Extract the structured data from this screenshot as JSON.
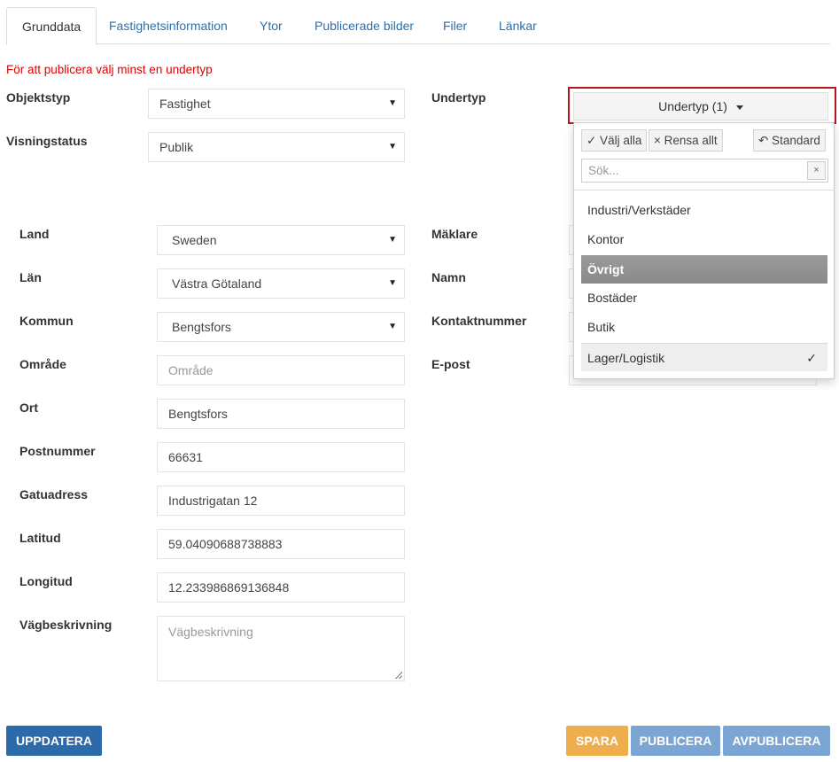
{
  "tabs": [
    {
      "label": "Grunddata",
      "active": true
    },
    {
      "label": "Fastighetsinformation"
    },
    {
      "label": "Ytor"
    },
    {
      "label": "Publicerade bilder"
    },
    {
      "label": "Filer"
    },
    {
      "label": "Länkar"
    }
  ],
  "warning": "För att publicera välj minst en undertyp",
  "form": {
    "objektstyp": {
      "label": "Objektstyp",
      "value": "Fastighet"
    },
    "visningstatus": {
      "label": "Visningstatus",
      "value": "Publik"
    },
    "undertyp": {
      "label": "Undertyp"
    },
    "land": {
      "label": "Land",
      "value": "Sweden"
    },
    "lan": {
      "label": "Län",
      "value": "Västra Götaland"
    },
    "kommun": {
      "label": "Kommun",
      "value": "Bengtsfors"
    },
    "omrade": {
      "label": "Område",
      "placeholder": "Område"
    },
    "ort": {
      "label": "Ort",
      "value": "Bengtsfors"
    },
    "postnummer": {
      "label": "Postnummer",
      "value": "66631"
    },
    "gatuadress": {
      "label": "Gatuadress",
      "value": "Industrigatan 12"
    },
    "latitud": {
      "label": "Latitud",
      "value": "59.04090688738883"
    },
    "longitud": {
      "label": "Longitud",
      "value": "12.233986869136848"
    },
    "vagbeskrivning": {
      "label": "Vägbeskrivning",
      "placeholder": "Vägbeskrivning"
    },
    "maklare": {
      "label": "Mäklare"
    },
    "namn": {
      "label": "Namn"
    },
    "kontaktnummer": {
      "label": "Kontaktnummer"
    },
    "epost": {
      "label": "E-post"
    }
  },
  "multiselect": {
    "button_label": "Undertyp (1)",
    "select_all": "✓ Välj alla",
    "clear_all": "× Rensa allt",
    "standard": "↶ Standard",
    "search_placeholder": "Sök...",
    "clear_icon": "×",
    "options": [
      {
        "label": "Industri/Verkstäder",
        "checked": false
      },
      {
        "label": "Kontor",
        "checked": false
      },
      {
        "label": "Övrigt",
        "checked": false,
        "hover": true
      },
      {
        "label": "Bostäder",
        "checked": false
      },
      {
        "label": "Butik",
        "checked": false
      },
      {
        "label": "Lager/Logistik",
        "checked": true
      }
    ],
    "check_mark": "✓"
  },
  "buttons": {
    "uppdatera": "UPPDATERA",
    "spara": "SPARA",
    "publicera": "PUBLICERA",
    "avpublicera": "AVPUBLICERA"
  },
  "colors": {
    "warning": "#e00000",
    "primary": "#2d6aaa",
    "warning_button": "#f0ad4e",
    "info_button": "#7ba6d3",
    "highlight_border": "#b5161b"
  }
}
